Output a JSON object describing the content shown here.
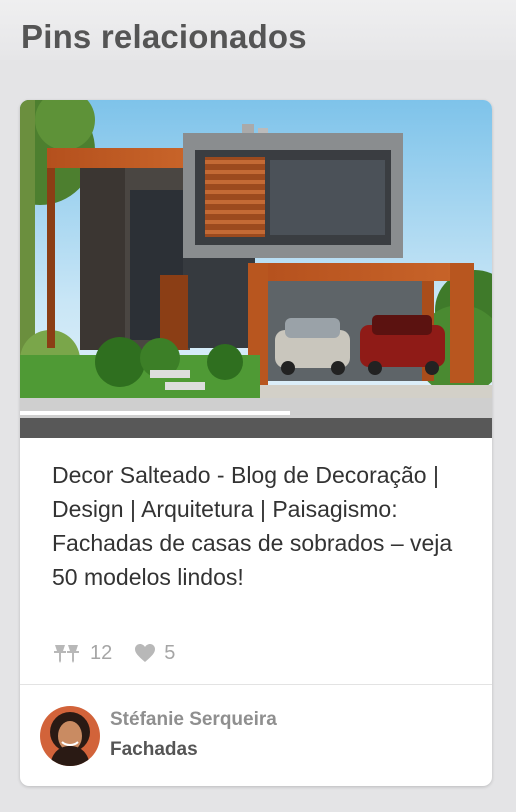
{
  "section": {
    "title": "Pins relacionados"
  },
  "pin": {
    "description": "Decor Salteado - Blog de Decoração | Design | Arquitetura | Paisagismo: Fachadas de casas de sobrados – veja 50 modelos lindos!",
    "repin_count": "12",
    "like_count": "5",
    "image_subject": "modern two-story house facade"
  },
  "pinner": {
    "name": "Stéfanie Serqueira",
    "board": "Fachadas"
  },
  "icons": {
    "repin": "pushpin-icon",
    "like": "heart-icon"
  },
  "colors": {
    "accent_muted": "#a5a5a5",
    "title": "#555555"
  }
}
